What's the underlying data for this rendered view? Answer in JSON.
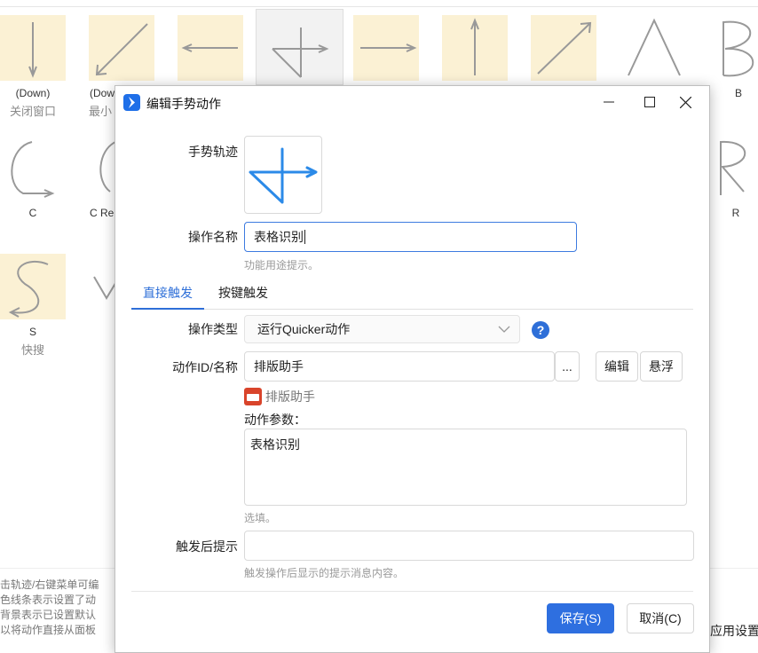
{
  "bg": {
    "row1": [
      {
        "name": "(Down)",
        "sub": "关闭窗口"
      },
      {
        "name": "(Dow",
        "sub": "最小"
      },
      {
        "name": "",
        "sub": ""
      },
      {
        "name": "",
        "sub": ""
      },
      {
        "name": "",
        "sub": ""
      },
      {
        "name": "",
        "sub": ""
      },
      {
        "name": "",
        "sub": ""
      },
      {
        "name": "",
        "sub": ""
      },
      {
        "name": "B",
        "sub": ""
      }
    ],
    "row2": [
      {
        "name": "C",
        "sub": ""
      },
      {
        "name": "C Re",
        "sub": ""
      },
      {
        "name": "R",
        "sub": ""
      }
    ],
    "row3": [
      {
        "name": "S",
        "sub": "快搜"
      }
    ],
    "footnotes": [
      "击轨迹/右键菜单可编",
      "色线条表示设置了动",
      "背景表示已设置默认",
      "以将动作直接从面板"
    ],
    "apply_button": "应用设置"
  },
  "dialog": {
    "title": "编辑手势动作",
    "fields": {
      "gesture_label": "手势轨迹",
      "name_label": "操作名称",
      "name_value": "表格识别",
      "name_hint": "功能用途提示。",
      "type_label": "操作类型",
      "type_value": "运行Quicker动作",
      "action_label": "动作ID/名称",
      "action_value": "排版助手",
      "browse_label": "...",
      "edit_label": "编辑",
      "float_label": "悬浮",
      "action_ref": "排版助手",
      "param_label": "动作参数：",
      "param_value": "表格识别",
      "param_hint": "选填。",
      "tip_label": "触发后提示",
      "tip_value": "",
      "tip_hint": "触发操作后显示的提示消息内容。"
    },
    "tabs": [
      {
        "label": "直接触发",
        "active": true
      },
      {
        "label": "按键触发",
        "active": false
      }
    ],
    "buttons": {
      "save": "保存(S)",
      "cancel": "取消(C)"
    },
    "help_glyph": "?"
  },
  "colors": {
    "accent": "#2e6fd8",
    "tile_highlight": "#fbf1d4",
    "gesture_stroke": "#2b8ae8"
  }
}
